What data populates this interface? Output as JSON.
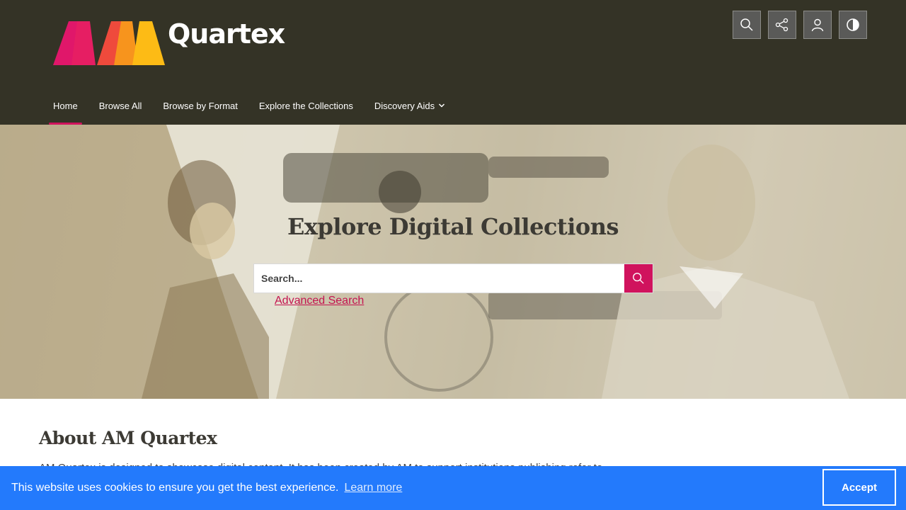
{
  "brand": {
    "mark": "AM",
    "name": "Quartex",
    "colors": {
      "pink": "#e0176a",
      "red": "#ef4a3c",
      "orange": "#f7941d",
      "yellow": "#fdbb15"
    }
  },
  "toolbar": {
    "buttons": [
      {
        "icon": "search-icon"
      },
      {
        "icon": "share-icon"
      },
      {
        "icon": "user-icon"
      },
      {
        "icon": "contrast-icon"
      }
    ]
  },
  "nav": {
    "items": [
      {
        "label": "Home",
        "active": true
      },
      {
        "label": "Browse All"
      },
      {
        "label": "Browse by Format"
      },
      {
        "label": "Explore the Collections"
      },
      {
        "label": "Discovery Aids",
        "has_dropdown": true
      }
    ]
  },
  "hero": {
    "title": "Explore Digital Collections",
    "search_placeholder": "Search...",
    "advanced_link": "Advanced Search"
  },
  "about": {
    "title": "About AM Quartex",
    "text": "AM Quartex is designed to showcase digital content. It has been created by AM to support institutions publishing refer to..."
  },
  "cookie": {
    "message": "This website uses cookies to ensure you get the best experience.",
    "learn_more": "Learn more",
    "accept": "Accept"
  },
  "colors": {
    "header_bg": "#343326",
    "accent": "#d0135d",
    "cookie_bg": "#237afc"
  }
}
